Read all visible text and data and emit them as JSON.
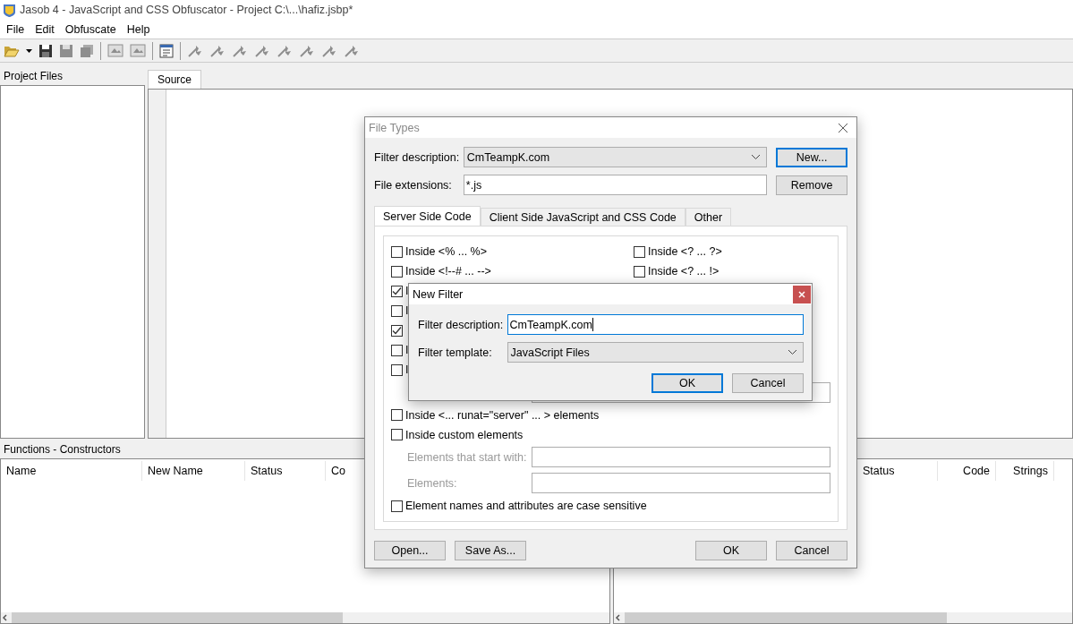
{
  "window": {
    "title": "Jasob 4 - JavaScript and CSS Obfuscator - Project  C:\\...\\hafiz.jsbp*"
  },
  "menu": [
    "File",
    "Edit",
    "Obfuscate",
    "Help"
  ],
  "project_files": {
    "title": "Project Files"
  },
  "editor": {
    "tabs": [
      {
        "label": "Source",
        "selected": true
      }
    ]
  },
  "functions_panel": {
    "title": "Functions - Constructors",
    "columns": [
      "Name",
      "New Name",
      "Status",
      "Co"
    ]
  },
  "right_panel": {
    "columns": [
      "Status",
      "Code",
      "Strings"
    ]
  },
  "file_types_dialog": {
    "title": "File Types",
    "filter_description_label": "Filter description:",
    "filter_description_value": "CmTeampK.com",
    "file_extensions_label": "File extensions:",
    "file_extensions_value": "*.js",
    "side_buttons": [
      {
        "label": "New...",
        "default": true
      },
      {
        "label": "Remove",
        "default": false
      }
    ],
    "tabs": [
      {
        "label": "Server Side Code",
        "selected": true
      },
      {
        "label": "Client Side JavaScript and CSS Code",
        "selected": false
      },
      {
        "label": "Other",
        "selected": false
      }
    ],
    "options_left": [
      {
        "label": "Inside <% ... %>",
        "checked": false
      },
      {
        "label": "Inside <!--# ... -->",
        "checked": false
      },
      {
        "label": "I",
        "checked": true
      },
      {
        "label": "I",
        "checked": false
      },
      {
        "checked": true
      },
      {
        "label": "I",
        "checked": false
      },
      {
        "label": "I",
        "checked": false
      }
    ],
    "options_right": [
      {
        "label": "Inside <? ... ?>",
        "checked": false
      },
      {
        "label": "Inside <? ... !>",
        "checked": false
      }
    ],
    "options_lower": [
      {
        "label": "Inside <... runat=\"server\" ... > elements",
        "checked": false
      },
      {
        "label": "Inside custom elements",
        "checked": false
      }
    ],
    "elements_start_label": "Elements that start with:",
    "elements_label": "Elements:",
    "case_sensitive": {
      "label": "Element names and attributes are case sensitive",
      "checked": false
    },
    "left_buttons": [
      {
        "label": "Open...",
        "default": false
      },
      {
        "label": "Save As...",
        "default": false
      }
    ],
    "right_buttons": [
      {
        "label": "OK",
        "default": false
      },
      {
        "label": "Cancel",
        "default": false
      }
    ]
  },
  "new_filter_dialog": {
    "title": "New Filter",
    "filter_description_label": "Filter description:",
    "filter_description_value": "CmTeampK.com",
    "filter_template_label": "Filter template:",
    "filter_template_value": "JavaScript Files",
    "buttons": [
      {
        "label": "OK",
        "default": true
      },
      {
        "label": "Cancel",
        "default": false
      }
    ]
  }
}
